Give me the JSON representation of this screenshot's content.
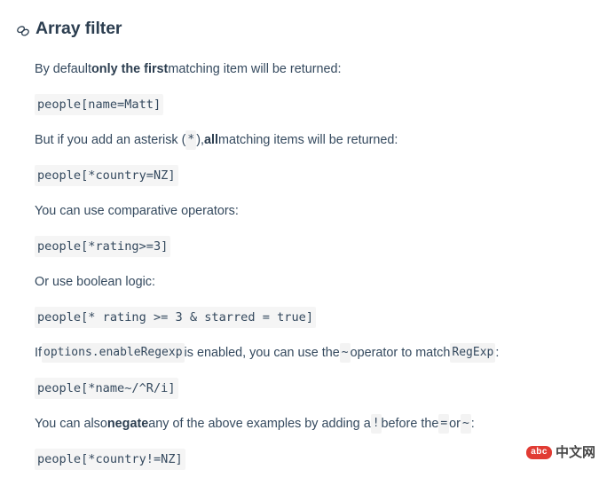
{
  "header": {
    "anchor_icon": "link-icon",
    "title": "Array filter"
  },
  "blocks": [
    {
      "type": "paragraph",
      "name": "paragraph-default-first",
      "parts": [
        {
          "kind": "text",
          "text": "By default "
        },
        {
          "kind": "bold",
          "text": "only the first"
        },
        {
          "kind": "text",
          "text": " matching item will be returned:"
        }
      ]
    },
    {
      "type": "code",
      "name": "code-name-matt",
      "text": "people[name=Matt]"
    },
    {
      "type": "paragraph",
      "name": "paragraph-asterisk-all",
      "parts": [
        {
          "kind": "text",
          "text": "But if you add an asterisk ("
        },
        {
          "kind": "code",
          "text": "*"
        },
        {
          "kind": "text",
          "text": "), "
        },
        {
          "kind": "bold",
          "text": "all"
        },
        {
          "kind": "text",
          "text": " matching items will be returned:"
        }
      ]
    },
    {
      "type": "code",
      "name": "code-country-nz",
      "text": "people[*country=NZ]"
    },
    {
      "type": "paragraph",
      "name": "paragraph-comparative-operators",
      "parts": [
        {
          "kind": "text",
          "text": "You can use comparative operators:"
        }
      ]
    },
    {
      "type": "code",
      "name": "code-rating-gte-3",
      "text": "people[*rating>=3]"
    },
    {
      "type": "paragraph",
      "name": "paragraph-boolean-logic",
      "parts": [
        {
          "kind": "text",
          "text": "Or use boolean logic:"
        }
      ]
    },
    {
      "type": "code",
      "name": "code-rating-and-starred",
      "text": "people[* rating >= 3 & starred = true]"
    },
    {
      "type": "paragraph",
      "name": "paragraph-enable-regexp",
      "parts": [
        {
          "kind": "text",
          "text": "If "
        },
        {
          "kind": "code",
          "text": "options.enableRegexp"
        },
        {
          "kind": "text",
          "text": " is enabled, you can use the "
        },
        {
          "kind": "code",
          "text": "~"
        },
        {
          "kind": "text",
          "text": " operator to match "
        },
        {
          "kind": "code",
          "text": "RegExp"
        },
        {
          "kind": "text",
          "text": ":"
        }
      ]
    },
    {
      "type": "code",
      "name": "code-name-regexp",
      "text": "people[*name~/^R/i]"
    },
    {
      "type": "paragraph",
      "name": "paragraph-negate",
      "parts": [
        {
          "kind": "text",
          "text": "You can also "
        },
        {
          "kind": "bold",
          "text": "negate"
        },
        {
          "kind": "text",
          "text": " any of the above examples by adding a "
        },
        {
          "kind": "code",
          "text": "!"
        },
        {
          "kind": "text",
          "text": " before the "
        },
        {
          "kind": "code",
          "text": "="
        },
        {
          "kind": "text",
          "text": " or "
        },
        {
          "kind": "code",
          "text": "~"
        },
        {
          "kind": "text",
          "text": ":"
        }
      ]
    },
    {
      "type": "code",
      "name": "code-country-not-nz",
      "text": "people[*country!=NZ]"
    }
  ],
  "watermark": {
    "badge": "abc",
    "text": "中文网"
  },
  "colors": {
    "heading": "#2c3e50",
    "body_text": "#34495e",
    "code_bg": "#f5f5f5",
    "inline_code_bg": "#f3f3f3",
    "watermark_badge": "#e03129",
    "page_bg": "#ffffff"
  }
}
